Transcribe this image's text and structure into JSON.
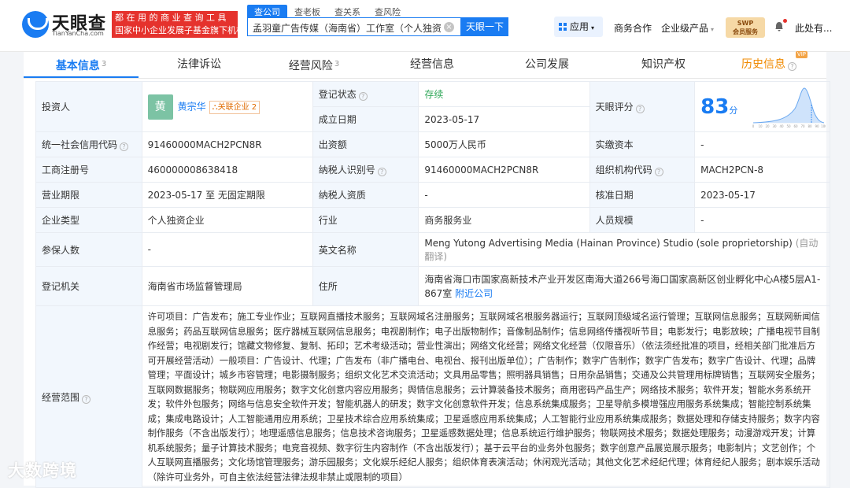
{
  "header": {
    "logo_title": "天眼查",
    "logo_sub": "TianYanCha.com",
    "slogan_line1": "都 在 用 的 商 业 查 询 工 具",
    "slogan_line2": "国家中小企业发展子基金旗下机构",
    "search_tabs": [
      "查公司",
      "查老板",
      "查关系",
      "查风险"
    ],
    "search_value": "孟羽童广告传媒（海南省）工作室（个人独资）",
    "search_button": "天眼一下",
    "nav_app": "应用",
    "nav_business": "商务合作",
    "nav_enterprise": "企业级产品",
    "swp_line1": "SWP",
    "swp_line2": "会员服务",
    "user": "此处有..."
  },
  "tabs": [
    {
      "label": "基本信息",
      "count": "3"
    },
    {
      "label": "法律诉讼",
      "count": ""
    },
    {
      "label": "经营风险",
      "count": "3"
    },
    {
      "label": "经营信息",
      "count": ""
    },
    {
      "label": "公司发展",
      "count": ""
    },
    {
      "label": "知识产权",
      "count": ""
    },
    {
      "label": "历史信息",
      "count": ""
    }
  ],
  "vip_badge": "VIP",
  "info": {
    "investor_label": "投资人",
    "investor_avatar": "黄",
    "investor_name": "黄宗华",
    "investor_related": "关联企业 2",
    "reg_status_label": "登记状态",
    "reg_status": "存续",
    "est_date_label": "成立日期",
    "est_date": "2023-05-17",
    "score_label": "天眼评分",
    "score": "83",
    "score_unit": "分",
    "credit_code_label": "统一社会信用代码",
    "credit_code": "91460000MACH2PCN8R",
    "capital_label": "出资额",
    "capital": "5000万人民币",
    "paid_capital_label": "实缴资本",
    "paid_capital": "-",
    "biz_reg_no_label": "工商注册号",
    "biz_reg_no": "460000008638418",
    "taxpayer_id_label": "纳税人识别号",
    "taxpayer_id": "91460000MACH2PCN8R",
    "org_code_label": "组织机构代码",
    "org_code": "MACH2PCN-8",
    "term_label": "营业期限",
    "term": "2023-05-17 至 无固定期限",
    "taxpayer_qual_label": "纳税人资质",
    "taxpayer_qual": "-",
    "approve_date_label": "核准日期",
    "approve_date": "2023-05-17",
    "type_label": "企业类型",
    "type": "个人独资企业",
    "industry_label": "行业",
    "industry": "商务服务业",
    "staff_label": "人员规模",
    "staff": "-",
    "insured_label": "参保人数",
    "insured": "-",
    "english_label": "英文名称",
    "english": "Meng Yutong Advertising Media (Hainan Province) Studio (sole proprietorship)",
    "auto_translate": "(自动翻译)",
    "authority_label": "登记机关",
    "authority": "海南省市场监督管理局",
    "address_label": "住所",
    "address": "海南省海口市国家高新技术产业开发区南海大道266号海口国家高新区创业孵化中心A楼5层A1-867室",
    "nearby": "附近公司",
    "scope_label": "经营范围",
    "scope": "许可项目：广告发布；施工专业作业；互联网直播技术服务；互联网域名注册服务；互联网域名根服务器运行；互联网顶级域名运行管理；互联网信息服务；互联网新闻信息服务；药品互联网信息服务；医疗器械互联网信息服务；电视剧制作；电子出版物制作；音像制品制作；信息网络传播视听节目；电影发行；电影放映；广播电视节目制作经营；电视剧发行；馆藏文物修复、复制、拓印；艺术考级活动；营业性演出；网络文化经营；网络文化经营（仅限音乐）（依法须经批准的项目，经相关部门批准后方可开展经营活动）一般项目：广告设计、代理；广告发布（非广播电台、电视台、报刊出版单位）；广告制作；数字广告制作；数字广告发布；数字广告设计、代理；品牌管理；平面设计；城乡市容管理；电影摄制服务；组织文化艺术交流活动；文具用品零售；照明器具销售；日用杂品销售；交通及公共管理用标牌销售；互联网安全服务；互联网数据服务；物联网应用服务；数字文化创意内容应用服务；舆情信息服务；云计算装备技术服务；商用密码产品生产；网络技术服务；软件开发；智能水务系统开发；软件外包服务；网络与信息安全软件开发；智能机器人的研发；数字文化创意软件开发；信息系统集成服务；卫星导航多模增强应用服务系统集成；智能控制系统集成；集成电路设计；人工智能通用应用系统；卫星技术综合应用系统集成；卫星遥感应用系统集成；人工智能行业应用系统集成服务；数据处理和存储支持服务；数字内容制作服务（不含出版发行）；地理遥感信息服务；信息技术咨询服务；卫星遥感数据处理；信息系统运行维护服务；物联网技术服务；数据处理服务；动漫游戏开发；计算机系统服务；量子计算技术服务；电竞音视频、数字衍生内容制作（不含出版发行）；基于云平台的业务外包服务；数字创意产品展览展示服务；电影制片；文艺创作；个人互联网直播服务；文化场馆管理服务；游乐园服务；文化娱乐经纪人服务；组织体育表演活动；休闲观光活动；其他文化艺术经纪代理；体育经纪人服务；剧本娱乐活动（除许可业务外，可自主依法经营法律法规非禁止或限制的项目）"
  },
  "chart": {
    "x_ticks": [
      "0",
      "10",
      "20",
      "30",
      "40",
      "50",
      "60",
      "70",
      "80",
      "90",
      "100"
    ]
  },
  "watermark": "大数跨境",
  "colors": {
    "brand": "#1a7cf2",
    "slogan": "#e5322d",
    "status": "#31a85a",
    "history": "#f08a00"
  }
}
